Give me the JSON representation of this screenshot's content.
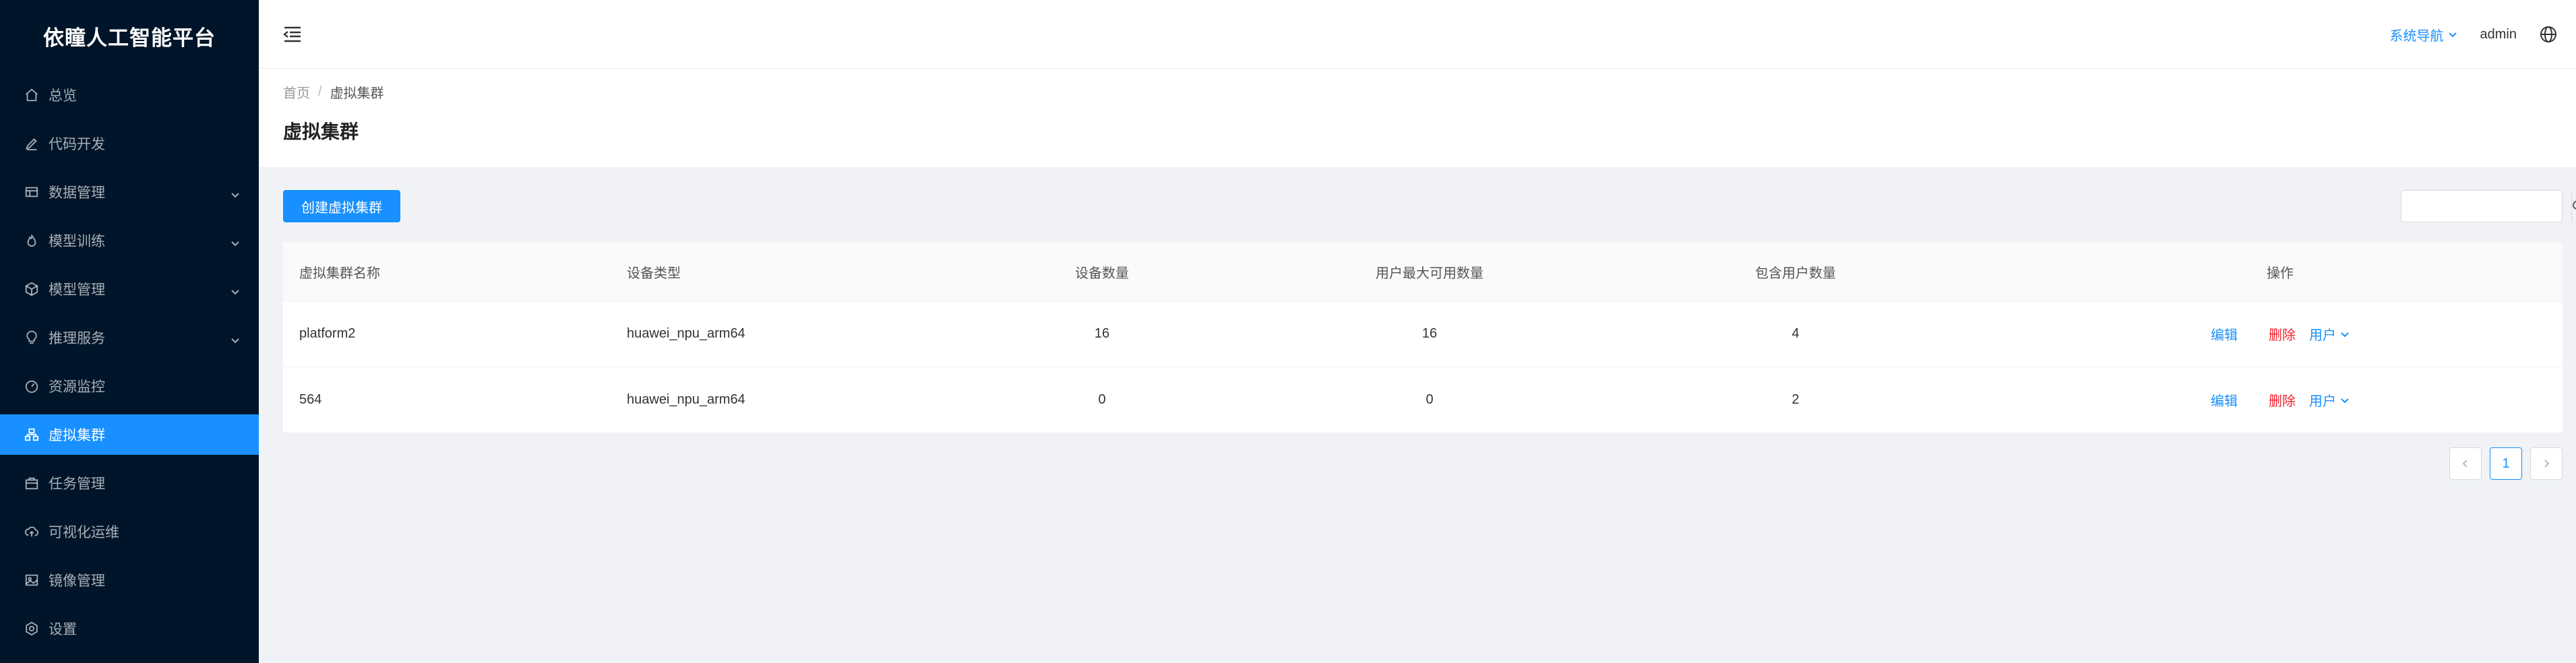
{
  "app": {
    "logo_text": "依瞳人工智能平台"
  },
  "sidebar": {
    "items": [
      {
        "label": "总览",
        "icon": "home-icon",
        "active": false,
        "has_arrow": false
      },
      {
        "label": "代码开发",
        "icon": "edit-icon",
        "active": false,
        "has_arrow": false
      },
      {
        "label": "数据管理",
        "icon": "database-icon",
        "active": false,
        "has_arrow": true
      },
      {
        "label": "模型训练",
        "icon": "fire-icon",
        "active": false,
        "has_arrow": true
      },
      {
        "label": "模型管理",
        "icon": "cube-icon",
        "active": false,
        "has_arrow": true
      },
      {
        "label": "推理服务",
        "icon": "bulb-icon",
        "active": false,
        "has_arrow": true
      },
      {
        "label": "资源监控",
        "icon": "dashboard-icon",
        "active": false,
        "has_arrow": false
      },
      {
        "label": "虚拟集群",
        "icon": "cluster-icon",
        "active": true,
        "has_arrow": false
      },
      {
        "label": "任务管理",
        "icon": "task-icon",
        "active": false,
        "has_arrow": false
      },
      {
        "label": "可视化运维",
        "icon": "cloud-upload-icon",
        "active": false,
        "has_arrow": false
      },
      {
        "label": "镜像管理",
        "icon": "image-icon",
        "active": false,
        "has_arrow": false
      },
      {
        "label": "设置",
        "icon": "settings-icon",
        "active": false,
        "has_arrow": false
      }
    ]
  },
  "header": {
    "system_nav": "系统导航",
    "user": "admin"
  },
  "breadcrumb": {
    "home": "首页",
    "separator": "/",
    "current": "虚拟集群"
  },
  "page": {
    "title": "虚拟集群"
  },
  "toolbar": {
    "create_label": "创建虚拟集群",
    "search_placeholder": "",
    "search_value": ""
  },
  "table": {
    "columns": [
      "虚拟集群名称",
      "设备类型",
      "设备数量",
      "用户最大可用数量",
      "包含用户数量",
      "操作"
    ],
    "rows": [
      {
        "name": "platform2",
        "device_type": "huawei_npu_arm64",
        "device_count": "16",
        "max_user_available": "16",
        "user_count": "4"
      },
      {
        "name": "564",
        "device_type": "huawei_npu_arm64",
        "device_count": "0",
        "max_user_available": "0",
        "user_count": "2"
      }
    ],
    "actions": {
      "edit": "编辑",
      "delete": "删除",
      "users": "用户"
    }
  },
  "pagination": {
    "current_page": "1"
  },
  "colors": {
    "sidebar_bg": "#001529",
    "accent": "#1890ff",
    "danger": "#f5222d",
    "content_bg": "#f0f2f5"
  }
}
